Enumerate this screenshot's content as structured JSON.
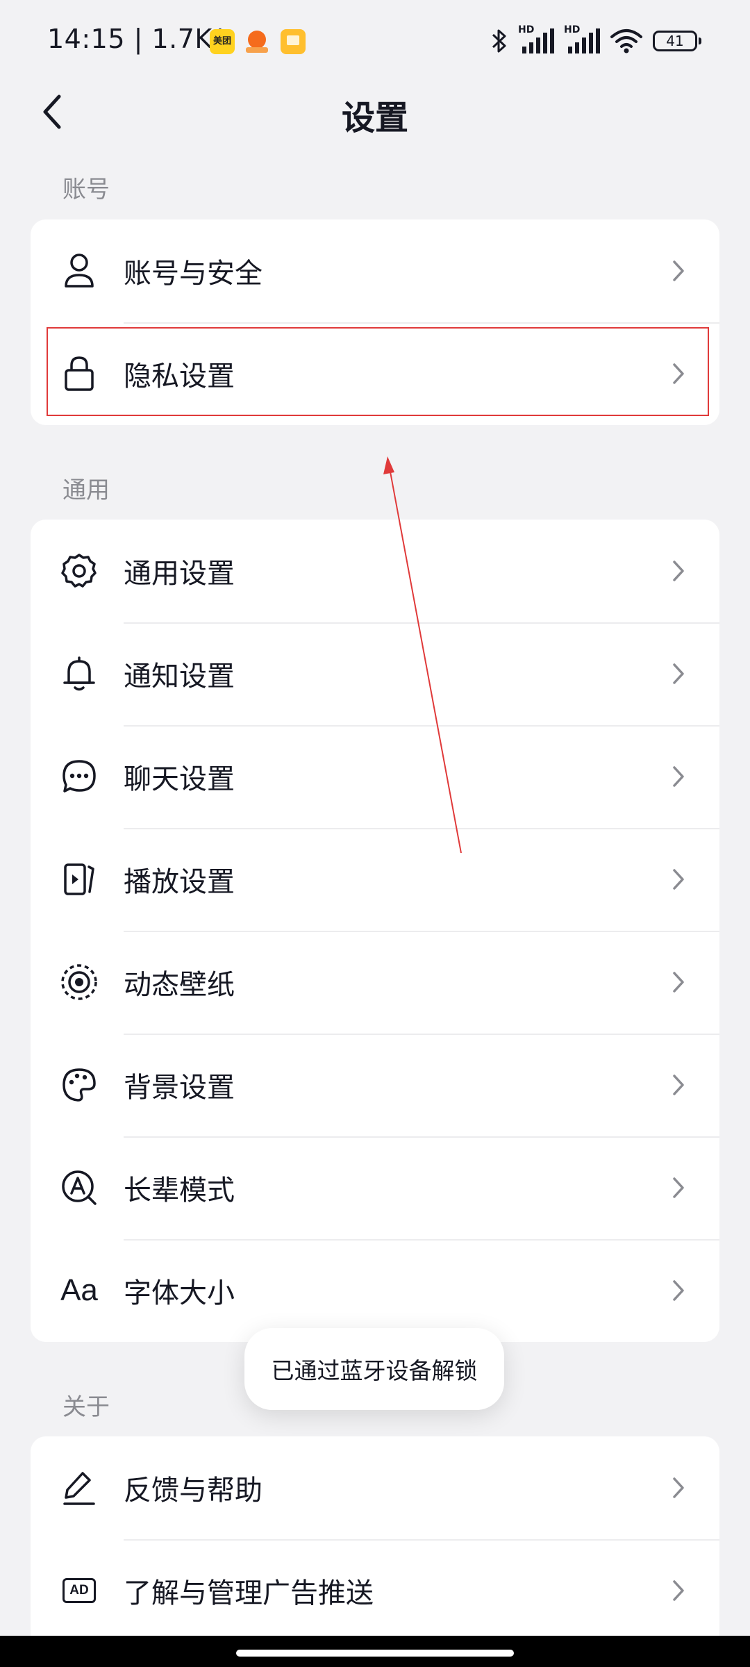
{
  "status_bar": {
    "time": "14:15",
    "net_speed": "1.7K/s",
    "meituan_label": "美团",
    "hd1": "HD",
    "hd2": "HD",
    "battery": "41"
  },
  "header": {
    "title": "设置"
  },
  "sections": {
    "account": {
      "label": "账号",
      "items": [
        {
          "label": "账号与安全",
          "icon": "person-icon"
        },
        {
          "label": "隐私设置",
          "icon": "lock-icon"
        }
      ]
    },
    "general": {
      "label": "通用",
      "items": [
        {
          "label": "通用设置",
          "icon": "gear-icon"
        },
        {
          "label": "通知设置",
          "icon": "bell-icon"
        },
        {
          "label": "聊天设置",
          "icon": "chat-bubble-icon"
        },
        {
          "label": "播放设置",
          "icon": "play-icon"
        },
        {
          "label": "动态壁纸",
          "icon": "live-wallpaper-icon"
        },
        {
          "label": "背景设置",
          "icon": "palette-icon"
        },
        {
          "label": "长辈模式",
          "icon": "elder-mode-icon"
        },
        {
          "label": "字体大小",
          "icon": "font-size-icon",
          "glyph": "Aa"
        }
      ]
    },
    "about": {
      "label": "关于",
      "items": [
        {
          "label": "反馈与帮助",
          "icon": "pen-icon"
        },
        {
          "label": "了解与管理广告推送",
          "icon": "ad-icon",
          "glyph": "AD"
        }
      ]
    }
  },
  "toast": {
    "text": "已通过蓝牙设备解锁"
  },
  "colors": {
    "background": "#f2f2f4",
    "card": "#ffffff",
    "text": "#161823",
    "secondary": "#8a8b91",
    "annotation": "#e03a3a"
  }
}
